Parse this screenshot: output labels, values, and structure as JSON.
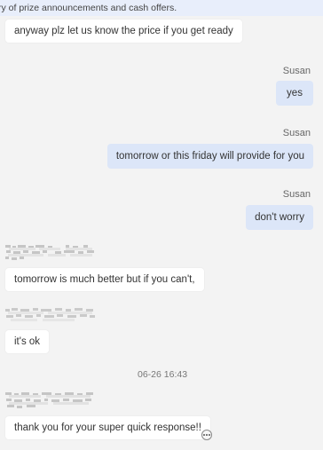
{
  "notice": "ry of prize announcements and cash offers.",
  "messages": [
    {
      "text": "anyway plz let us know the price if you get ready"
    },
    {
      "sender": "Susan",
      "text": "yes"
    },
    {
      "sender": "Susan",
      "text": "tomorrow or this friday will provide for you"
    },
    {
      "sender": "Susan",
      "text": "don't worry"
    },
    {
      "text": "tomorrow is much better but if you can't,"
    },
    {
      "text": "it's ok"
    },
    {
      "text": "thank you for your super quick response!!"
    }
  ],
  "timestamp": "06-26 16:43",
  "icons": {
    "more": "ellipsis-circle-icon",
    "redacted": "pixelated-name"
  },
  "colors": {
    "outgoing_bubble": "#dce6f8",
    "incoming_bubble": "#ffffff",
    "notice_bar": "#e8eefb",
    "background": "#f3f3f3"
  }
}
